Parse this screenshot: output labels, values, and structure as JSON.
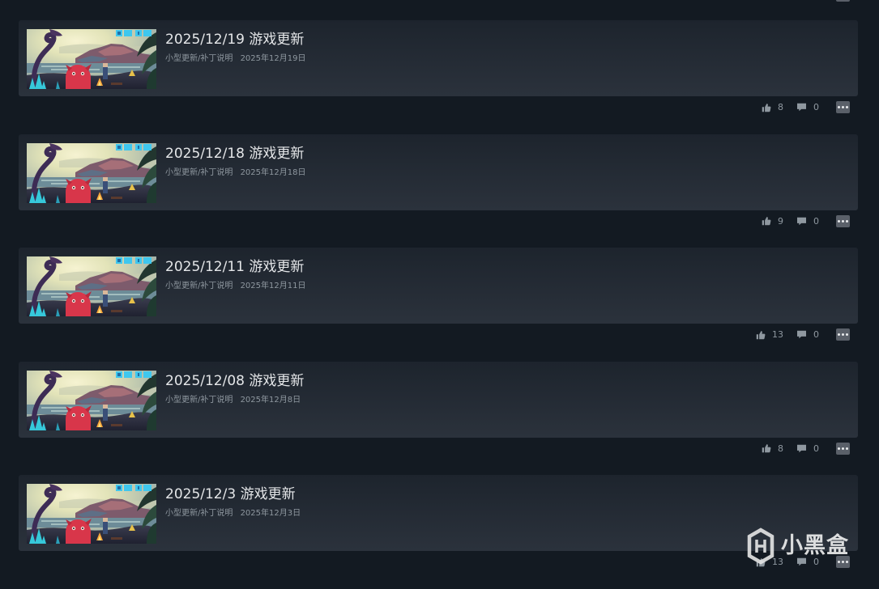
{
  "posts": [
    {
      "title": "2025/12/19 游戏更新",
      "category": "小型更新/补丁说明",
      "date": "2025年12月19日",
      "likes": "8",
      "comments": "0"
    },
    {
      "title": "2025/12/18 游戏更新",
      "category": "小型更新/补丁说明",
      "date": "2025年12月18日",
      "likes": "9",
      "comments": "0"
    },
    {
      "title": "2025/12/11 游戏更新",
      "category": "小型更新/补丁说明",
      "date": "2025年12月11日",
      "likes": "13",
      "comments": "0"
    },
    {
      "title": "2025/12/08 游戏更新",
      "category": "小型更新/补丁说明",
      "date": "2025年12月8日",
      "likes": "8",
      "comments": "0"
    },
    {
      "title": "2025/12/3 游戏更新",
      "category": "小型更新/补丁说明",
      "date": "2025年12月3日",
      "likes": "13",
      "comments": "0"
    }
  ],
  "icons": {
    "like": "thumbs-up-icon",
    "comment": "comment-icon",
    "more": "ellipsis-icon",
    "watermark": "xiaoheihe-logo-icon"
  },
  "colors": {
    "page_background": "#131a22",
    "card_top": "#1d242d",
    "card_bottom": "#2b323c",
    "title_text": "#e4e6e8",
    "muted_text": "#8f98a0",
    "more_button": "#5a6069"
  },
  "watermark": {
    "text": "小黑盒"
  }
}
